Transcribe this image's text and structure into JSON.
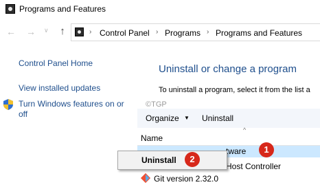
{
  "window": {
    "title": "Programs and Features"
  },
  "navigation": {
    "back_glyph": "←",
    "forward_glyph": "→",
    "recent_glyph": "∨",
    "up_glyph": "↑",
    "breadcrumb": [
      "Control Panel",
      "Programs",
      "Programs and Features"
    ],
    "separator": "›"
  },
  "sidebar": {
    "links": [
      "Control Panel Home",
      "View installed updates",
      "Turn Windows features on or off"
    ]
  },
  "main": {
    "title": "Uninstall or change a program",
    "description": "To uninstall a program, select it from the list a",
    "watermark": "©TGP"
  },
  "toolbar": {
    "organize_label": "Organize",
    "organize_arrow": "▼",
    "uninstall_label": "Uninstall",
    "sort_caret": "^"
  },
  "list": {
    "column_name": "Name",
    "rows": [
      {
        "text": "tware",
        "selected": true
      },
      {
        "text": "Host Controller",
        "selected": false
      },
      {
        "text": "Git version 2.32.0",
        "selected": false,
        "icon": "git-icon"
      }
    ]
  },
  "context_menu": {
    "items": [
      "Uninstall"
    ]
  },
  "annotations": {
    "badge_1": "1",
    "badge_2": "2",
    "badge_color": "#d7281a"
  },
  "colors": {
    "link": "#1e4e8c",
    "selection": "#cce8ff",
    "toolbar_bg": "#f3f6fb"
  }
}
